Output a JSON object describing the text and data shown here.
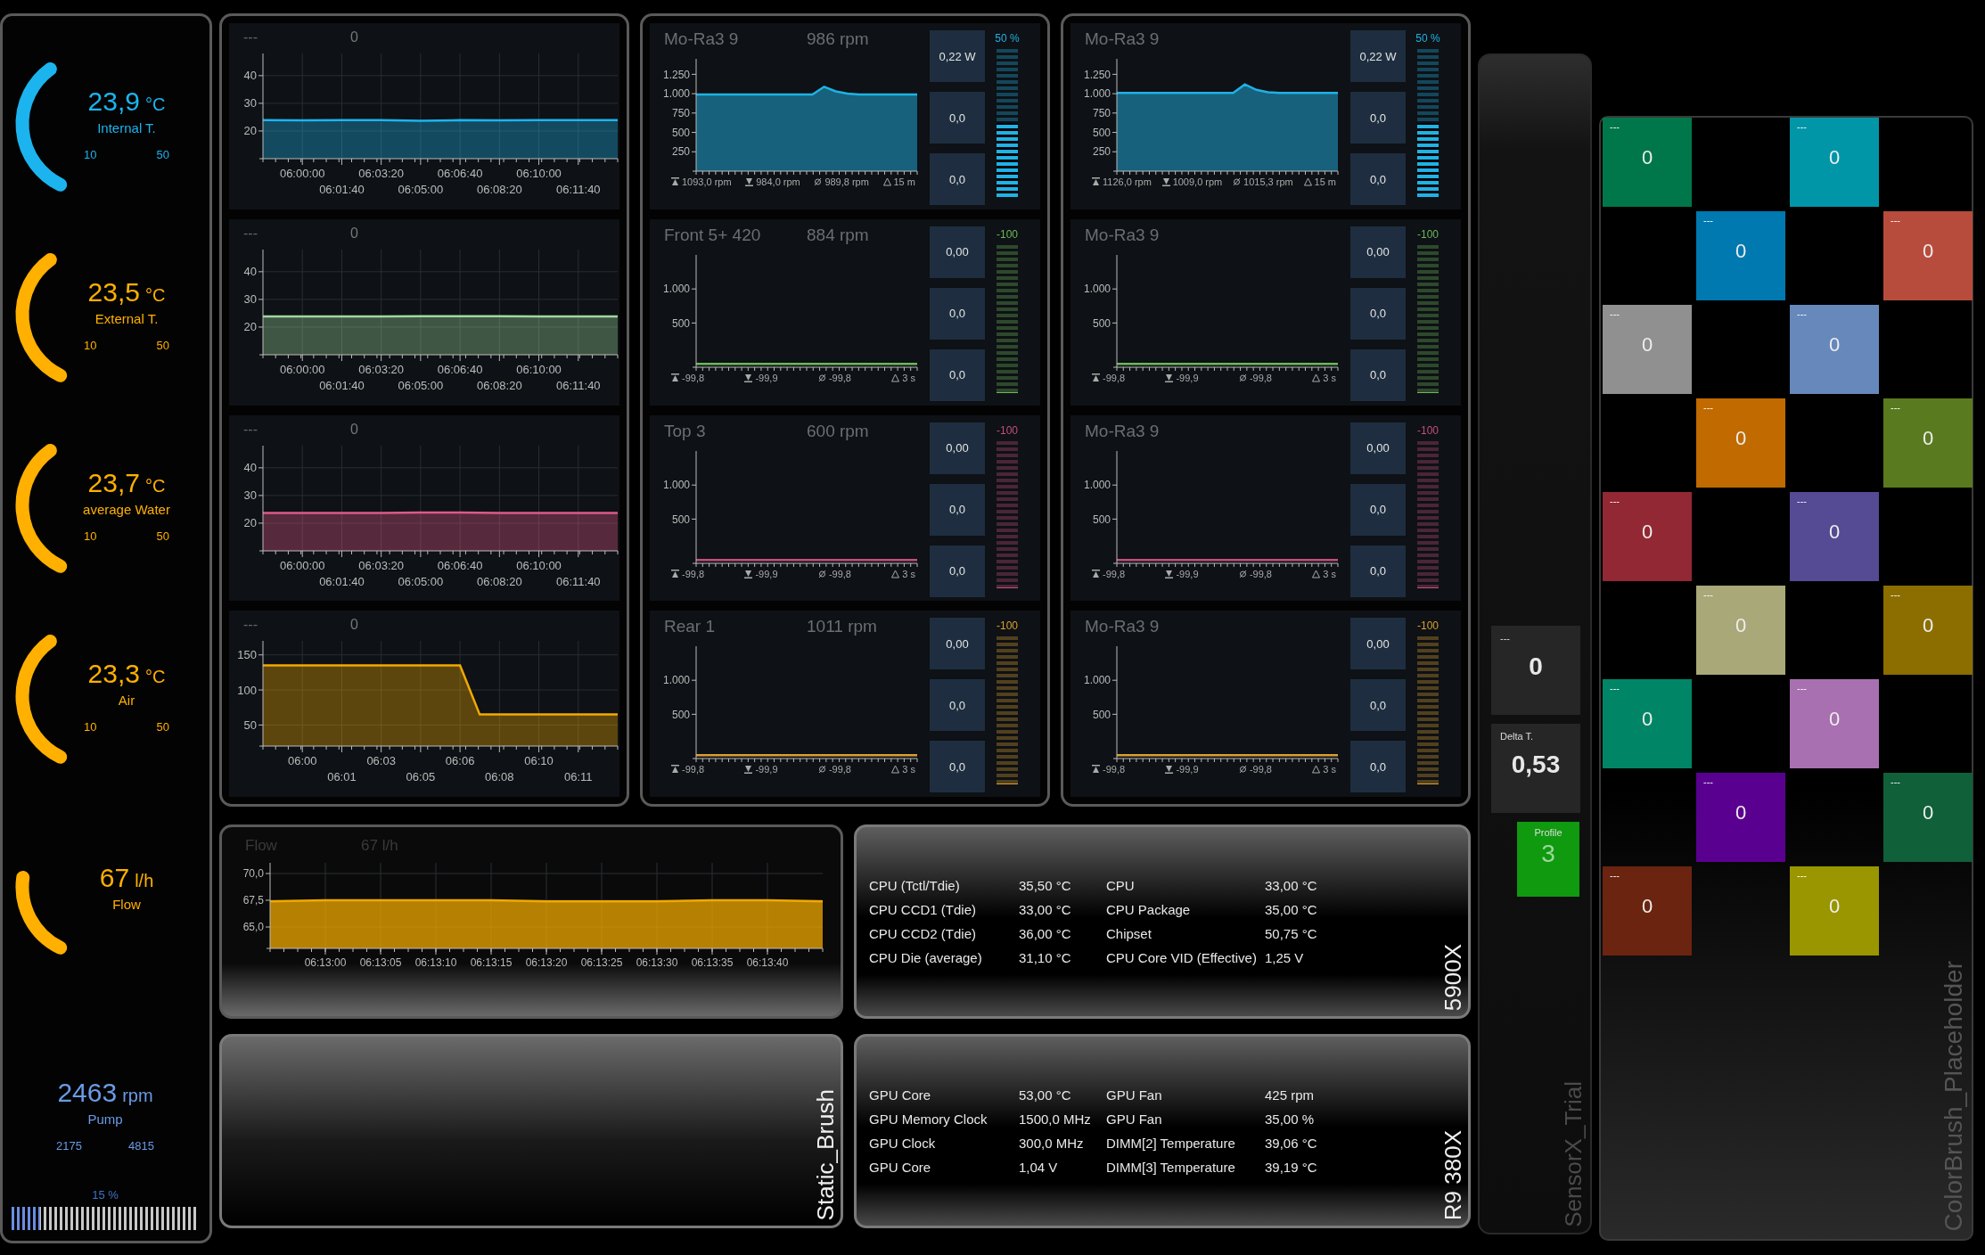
{
  "gauges": [
    {
      "value": "23,9",
      "unit": "°C",
      "label": "Internal T.",
      "min": "10",
      "max": "50",
      "color": "#1cb4ee"
    },
    {
      "value": "23,5",
      "unit": "°C",
      "label": "External T.",
      "min": "10",
      "max": "50",
      "color": "#ffb000"
    },
    {
      "value": "23,7",
      "unit": "°C",
      "label": "average Water",
      "min": "10",
      "max": "50",
      "color": "#ffb000"
    },
    {
      "value": "23,3",
      "unit": "°C",
      "label": "Air",
      "min": "10",
      "max": "50",
      "color": "#ffb000"
    },
    {
      "value": "67",
      "unit": "l/h",
      "label": "Flow",
      "color": "#ffb000"
    }
  ],
  "pump": {
    "value": "2463",
    "unit": "rpm",
    "label": "Pump",
    "min": "2175",
    "max": "4815",
    "percent": "15 %",
    "level": 0.15
  },
  "temperature_charts": [
    {
      "label": "---",
      "value": "0",
      "chart_data": {
        "type": "area",
        "grid": true,
        "categories": [
          null,
          "06:00:00",
          "06:01:40",
          "06:03:20",
          "06:05:00",
          "06:06:40",
          "06:08:20",
          "06:10:00",
          "06:11:40",
          null
        ],
        "ylim": [
          10,
          48
        ],
        "yticks": [
          20,
          30,
          40
        ],
        "series": [
          {
            "color": "#1cb4ee",
            "values": [
              23.9,
              23.8,
              23.9,
              23.9,
              23.7,
              23.9,
              23.8,
              23.9,
              23.9,
              23.9
            ]
          }
        ]
      }
    },
    {
      "label": "---",
      "value": "0",
      "chart_data": {
        "type": "area",
        "grid": true,
        "categories": [
          null,
          "06:00:00",
          "06:01:40",
          "06:03:20",
          "06:05:00",
          "06:06:40",
          "06:08:20",
          "06:10:00",
          "06:11:40",
          null
        ],
        "ylim": [
          10,
          48
        ],
        "yticks": [
          20,
          30,
          40
        ],
        "series": [
          {
            "color": "#9fd8a0",
            "values": [
              23.8,
              23.8,
              23.8,
              23.8,
              23.9,
              23.9,
              23.9,
              23.8,
              23.8,
              23.8
            ]
          }
        ]
      }
    },
    {
      "label": "---",
      "value": "0",
      "chart_data": {
        "type": "area",
        "grid": true,
        "categories": [
          null,
          "06:00:00",
          "06:01:40",
          "06:03:20",
          "06:05:00",
          "06:06:40",
          "06:08:20",
          "06:10:00",
          "06:11:40",
          null
        ],
        "ylim": [
          10,
          48
        ],
        "yticks": [
          20,
          30,
          40
        ],
        "series": [
          {
            "color": "#dc5a88",
            "values": [
              23.7,
              23.7,
              23.7,
              23.7,
              23.8,
              23.8,
              23.7,
              23.7,
              23.7,
              23.7
            ]
          }
        ]
      }
    },
    {
      "label": "---",
      "value": "0",
      "chart_data": {
        "type": "area",
        "grid": true,
        "categories": [
          null,
          null,
          "06:00",
          null,
          "06:01",
          null,
          "06:03",
          null,
          "06:05",
          null,
          "06:06",
          null,
          "06:08",
          null,
          "06:10",
          null,
          "06:11",
          null,
          null
        ],
        "ylim": [
          20,
          170
        ],
        "yticks": [
          50,
          100,
          150
        ],
        "series": [
          {
            "color": "#f2a900",
            "values": [
              135,
              135,
              135,
              135,
              135,
              135,
              135,
              135,
              135,
              135,
              135,
              65,
              65,
              65,
              65,
              65,
              65,
              65,
              65
            ]
          }
        ]
      }
    }
  ],
  "fan_panels": [
    {
      "fans": [
        {
          "name": "Mo-Ra3 9",
          "speed": "986 rpm",
          "color": "#1fb2e6",
          "percent": "50 %",
          "level": 0.5,
          "readouts": [
            "0,22 W",
            "0,0",
            "0,0"
          ],
          "stats": [
            "1093,0 rpm",
            "984,0 rpm",
            "989,8 rpm",
            "15 m"
          ],
          "chart_data": {
            "type": "area",
            "categories": [
              null,
              null,
              null,
              null,
              null,
              null,
              null,
              null,
              null,
              null,
              null,
              null,
              null,
              null,
              null,
              null,
              null,
              null,
              null,
              null
            ],
            "ylim": [
              0,
              1450
            ],
            "yticks": [
              {
                "value": 250,
                "label": "250"
              },
              {
                "value": 500,
                "label": "500"
              },
              {
                "value": 750,
                "label": "750"
              },
              {
                "value": 1000,
                "label": "1.000"
              },
              {
                "value": 1250,
                "label": "1.250"
              }
            ],
            "series": [
              {
                "color": "#1fb2e6",
                "values": [
                  990,
                  990,
                  990,
                  990,
                  990,
                  990,
                  990,
                  990,
                  990,
                  990,
                  990,
                  1090,
                  1030,
                  1000,
                  990,
                  990,
                  990,
                  990,
                  990,
                  990
                ]
              }
            ]
          }
        },
        {
          "name": "Front 5+ 420",
          "speed": "884 rpm",
          "color": "#6cb85a",
          "percent": "-100",
          "level": 0,
          "readouts": [
            "0,00",
            "0,0",
            "0,0"
          ],
          "stats": [
            "-99,8",
            "-99,9",
            "-99,8",
            "3 s"
          ],
          "chart_data": {
            "type": "line",
            "categories": [
              null,
              null,
              null,
              null,
              null,
              null,
              null,
              null,
              null,
              null
            ],
            "ylim": [
              -150,
              1500
            ],
            "yticks": [
              {
                "value": 500,
                "label": "500"
              },
              {
                "value": 1000,
                "label": "1.000"
              }
            ],
            "series": [
              {
                "color": "#6cb85a",
                "values": [
                  -100,
                  -100,
                  -100,
                  -100,
                  -100,
                  -100,
                  -100,
                  -100,
                  -100,
                  -100
                ]
              }
            ]
          }
        },
        {
          "name": "Top 3",
          "speed": "600 rpm",
          "color": "#c24f7c",
          "percent": "-100",
          "level": 0,
          "readouts": [
            "0,00",
            "0,0",
            "0,0"
          ],
          "stats": [
            "-99,8",
            "-99,9",
            "-99,8",
            "3 s"
          ],
          "chart_data": {
            "type": "line",
            "categories": [
              null,
              null,
              null,
              null,
              null,
              null,
              null,
              null,
              null,
              null
            ],
            "ylim": [
              -150,
              1500
            ],
            "yticks": [
              {
                "value": 500,
                "label": "500"
              },
              {
                "value": 1000,
                "label": "1.000"
              }
            ],
            "series": [
              {
                "color": "#c24f7c",
                "values": [
                  -100,
                  -100,
                  -100,
                  -100,
                  -100,
                  -100,
                  -100,
                  -100,
                  -100,
                  -100
                ]
              }
            ]
          }
        },
        {
          "name": "Rear 1",
          "speed": "1011 rpm",
          "color": "#d9a030",
          "percent": "-100",
          "level": 0,
          "readouts": [
            "0,00",
            "0,0",
            "0,0"
          ],
          "stats": [
            "-99,8",
            "-99,9",
            "-99,8",
            "3 s"
          ],
          "chart_data": {
            "type": "line",
            "categories": [
              null,
              null,
              null,
              null,
              null,
              null,
              null,
              null,
              null,
              null
            ],
            "ylim": [
              -150,
              1500
            ],
            "yticks": [
              {
                "value": 500,
                "label": "500"
              },
              {
                "value": 1000,
                "label": "1.000"
              }
            ],
            "series": [
              {
                "color": "#d9a030",
                "values": [
                  -100,
                  -100,
                  -100,
                  -100,
                  -100,
                  -100,
                  -100,
                  -100,
                  -100,
                  -100
                ]
              }
            ]
          }
        }
      ]
    },
    {
      "fans": [
        {
          "name": "Mo-Ra3 9",
          "color": "#1fb2e6",
          "percent": "50 %",
          "level": 0.5,
          "readouts": [
            "0,22 W",
            "0,0",
            "0,0"
          ],
          "stats": [
            "1126,0 rpm",
            "1009,0 rpm",
            "1015,3 rpm",
            "15 m"
          ],
          "chart_data": {
            "type": "area",
            "categories": [
              null,
              null,
              null,
              null,
              null,
              null,
              null,
              null,
              null,
              null,
              null,
              null,
              null,
              null,
              null,
              null,
              null,
              null,
              null,
              null
            ],
            "ylim": [
              0,
              1450
            ],
            "yticks": [
              {
                "value": 250,
                "label": "250"
              },
              {
                "value": 500,
                "label": "500"
              },
              {
                "value": 750,
                "label": "750"
              },
              {
                "value": 1000,
                "label": "1.000"
              },
              {
                "value": 1250,
                "label": "1.250"
              }
            ],
            "series": [
              {
                "color": "#1fb2e6",
                "values": [
                  1010,
                  1010,
                  1010,
                  1010,
                  1010,
                  1010,
                  1010,
                  1010,
                  1010,
                  1010,
                  1010,
                  1120,
                  1050,
                  1020,
                  1010,
                  1010,
                  1010,
                  1010,
                  1010,
                  1010
                ]
              }
            ]
          }
        },
        {
          "name": "Mo-Ra3 9",
          "color": "#6cb85a",
          "percent": "-100",
          "level": 0,
          "readouts": [
            "0,00",
            "0,0",
            "0,0"
          ],
          "stats": [
            "-99,8",
            "-99,9",
            "-99,8",
            "3 s"
          ],
          "chart_data": {
            "type": "line",
            "categories": [
              null,
              null,
              null,
              null,
              null,
              null,
              null,
              null,
              null,
              null
            ],
            "ylim": [
              -150,
              1500
            ],
            "yticks": [
              {
                "value": 500,
                "label": "500"
              },
              {
                "value": 1000,
                "label": "1.000"
              }
            ],
            "series": [
              {
                "color": "#6cb85a",
                "values": [
                  -100,
                  -100,
                  -100,
                  -100,
                  -100,
                  -100,
                  -100,
                  -100,
                  -100,
                  -100
                ]
              }
            ]
          }
        },
        {
          "name": "Mo-Ra3 9",
          "color": "#c24f7c",
          "percent": "-100",
          "level": 0,
          "readouts": [
            "0,00",
            "0,0",
            "0,0"
          ],
          "stats": [
            "-99,8",
            "-99,9",
            "-99,8",
            "3 s"
          ],
          "chart_data": {
            "type": "line",
            "categories": [
              null,
              null,
              null,
              null,
              null,
              null,
              null,
              null,
              null,
              null
            ],
            "ylim": [
              -150,
              1500
            ],
            "yticks": [
              {
                "value": 500,
                "label": "500"
              },
              {
                "value": 1000,
                "label": "1.000"
              }
            ],
            "series": [
              {
                "color": "#c24f7c",
                "values": [
                  -100,
                  -100,
                  -100,
                  -100,
                  -100,
                  -100,
                  -100,
                  -100,
                  -100,
                  -100
                ]
              }
            ]
          }
        },
        {
          "name": "Mo-Ra3 9",
          "color": "#d9a030",
          "percent": "-100",
          "level": 0,
          "readouts": [
            "0,00",
            "0,0",
            "0,0"
          ],
          "stats": [
            "-99,8",
            "-99,9",
            "-99,8",
            "3 s"
          ],
          "chart_data": {
            "type": "line",
            "categories": [
              null,
              null,
              null,
              null,
              null,
              null,
              null,
              null,
              null,
              null
            ],
            "ylim": [
              -150,
              1500
            ],
            "yticks": [
              {
                "value": 500,
                "label": "500"
              },
              {
                "value": 1000,
                "label": "1.000"
              }
            ],
            "series": [
              {
                "color": "#d9a030",
                "values": [
                  -100,
                  -100,
                  -100,
                  -100,
                  -100,
                  -100,
                  -100,
                  -100,
                  -100,
                  -100
                ]
              }
            ]
          }
        }
      ]
    }
  ],
  "flow_chart": {
    "label": "Flow",
    "value": "67 l/h",
    "chart_data": {
      "type": "area",
      "grid": true,
      "categories": [
        null,
        "06:13:00",
        "06:13:05",
        "06:13:10",
        "06:13:15",
        "06:13:20",
        "06:13:25",
        "06:13:30",
        "06:13:35",
        "06:13:40",
        null
      ],
      "ylim": [
        63,
        71
      ],
      "yticks": [
        {
          "value": 65,
          "label": "65,0"
        },
        {
          "value": 67.5,
          "label": "67,5"
        },
        {
          "value": 70,
          "label": "70,0"
        }
      ],
      "series": [
        {
          "color": "#f0a800",
          "values": [
            67.4,
            67.5,
            67.5,
            67.5,
            67.5,
            67.4,
            67.4,
            67.4,
            67.5,
            67.5,
            67.4
          ]
        }
      ]
    }
  },
  "static_brush": {
    "title": "Static_Brush"
  },
  "sensor_tables": [
    {
      "title": "5900X",
      "left": [
        {
          "name": "CPU (Tctl/Tdie)",
          "value": "35,50 °C"
        },
        {
          "name": "CPU CCD1 (Tdie)",
          "value": "33,00 °C"
        },
        {
          "name": "CPU CCD2 (Tdie)",
          "value": "36,00 °C"
        },
        {
          "name": "CPU Die (average)",
          "value": "31,10 °C"
        }
      ],
      "right": [
        {
          "name": "CPU",
          "value": "33,00 °C"
        },
        {
          "name": "CPU Package",
          "value": "35,00 °C"
        },
        {
          "name": "Chipset",
          "value": "50,75 °C"
        },
        {
          "name": "CPU Core VID (Effective)",
          "value": "1,25 V"
        }
      ]
    },
    {
      "title": "R9 380X",
      "left": [
        {
          "name": "GPU Core",
          "value": "53,00 °C"
        },
        {
          "name": "GPU Memory Clock",
          "value": "1500,0 MHz"
        },
        {
          "name": "GPU Clock",
          "value": "300,0 MHz"
        },
        {
          "name": "GPU Core",
          "value": "1,04 V"
        }
      ],
      "right": [
        {
          "name": "GPU Fan",
          "value": "425 rpm"
        },
        {
          "name": "GPU Fan",
          "value": "35,00 %"
        },
        {
          "name": "DIMM[2] Temperature",
          "value": "39,06 °C"
        },
        {
          "name": "DIMM[3] Temperature",
          "value": "39,19 °C"
        }
      ]
    }
  ],
  "sensor_column": {
    "title": "SensorX_Trial",
    "tiles": [
      {
        "label": "---",
        "value": "0"
      },
      {
        "label": "Delta T.",
        "value": "0,53"
      }
    ],
    "profile": {
      "label": "Profile",
      "value": "3"
    }
  },
  "color_grid": {
    "title": "ColorBrush_Placeholder",
    "tiles": [
      {
        "label": "---",
        "value": "0",
        "color": "#00774a"
      },
      {
        "label": "---",
        "value": "0",
        "color": "#0096a8"
      },
      {
        "label": "---",
        "value": "0",
        "color": "#0078b0"
      },
      {
        "label": "---",
        "value": "0",
        "color": "#b84c3c"
      },
      {
        "label": "---",
        "value": "0",
        "color": "#909090"
      },
      {
        "label": "---",
        "value": "0",
        "color": "#6688bb"
      },
      {
        "label": "---",
        "value": "0",
        "color": "#c06a00"
      },
      {
        "label": "---",
        "value": "0",
        "color": "#5a7a20"
      },
      {
        "label": "---",
        "value": "0",
        "color": "#922833"
      },
      {
        "label": "---",
        "value": "0",
        "color": "#554a94"
      },
      {
        "label": "---",
        "value": "0",
        "color": "#a8a878"
      },
      {
        "label": "---",
        "value": "0",
        "color": "#8c6e00"
      },
      {
        "label": "---",
        "value": "0",
        "color": "#008566"
      },
      {
        "label": "---",
        "value": "0",
        "color": "#a870b0"
      },
      {
        "label": "---",
        "value": "0",
        "color": "#5a0090"
      },
      {
        "label": "---",
        "value": "0",
        "color": "#10603a"
      },
      {
        "label": "---",
        "value": "0",
        "color": "#6a2410"
      },
      {
        "label": "---",
        "value": "0",
        "color": "#9a9600"
      }
    ]
  }
}
